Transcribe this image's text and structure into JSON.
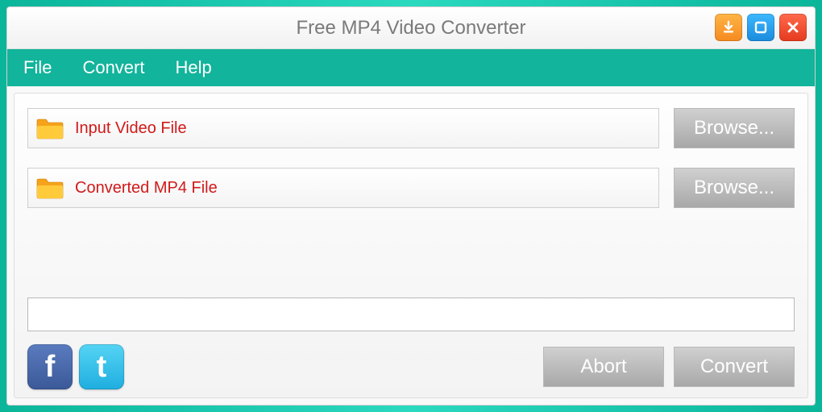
{
  "title": "Free MP4 Video Converter",
  "window_buttons": {
    "download": "download-icon",
    "maximize": "maximize-icon",
    "close": "close-icon"
  },
  "menu": {
    "file": "File",
    "convert": "Convert",
    "help": "Help"
  },
  "fields": {
    "input": {
      "label": "Input Video File",
      "browse": "Browse..."
    },
    "output": {
      "label": "Converted MP4 File",
      "browse": "Browse..."
    }
  },
  "progress": {
    "value": ""
  },
  "actions": {
    "abort": "Abort",
    "convert": "Convert"
  },
  "social": {
    "facebook": "f",
    "twitter": "t"
  }
}
